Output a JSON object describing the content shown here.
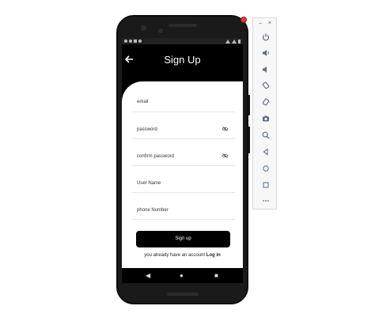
{
  "screen": {
    "back_icon": "arrow-left-icon",
    "title": "Sign Up",
    "fields": [
      {
        "label": "email"
      },
      {
        "label": "password",
        "icon": "eye-off-icon"
      },
      {
        "label": "confirm password",
        "icon": "eye-off-icon"
      },
      {
        "label": "User Name"
      },
      {
        "label": "phone Number"
      }
    ],
    "signup_button": "Sign up",
    "account_text": "you already have an account",
    "login_link": "Log in",
    "nav": {
      "back": "◀",
      "home": "●",
      "recents": "■"
    }
  },
  "toolbar": {
    "minimize": "–",
    "close": "×",
    "buttons": [
      "power-icon",
      "volume-up-icon",
      "volume-down-icon",
      "rotate-left-icon",
      "rotate-right-icon",
      "camera-icon",
      "zoom-icon",
      "back-icon",
      "home-icon",
      "overview-icon",
      "more-icon"
    ]
  },
  "colors": {
    "accent": "#000000",
    "toolbar_icon": "#5a6a86",
    "card": "#ffffff"
  }
}
